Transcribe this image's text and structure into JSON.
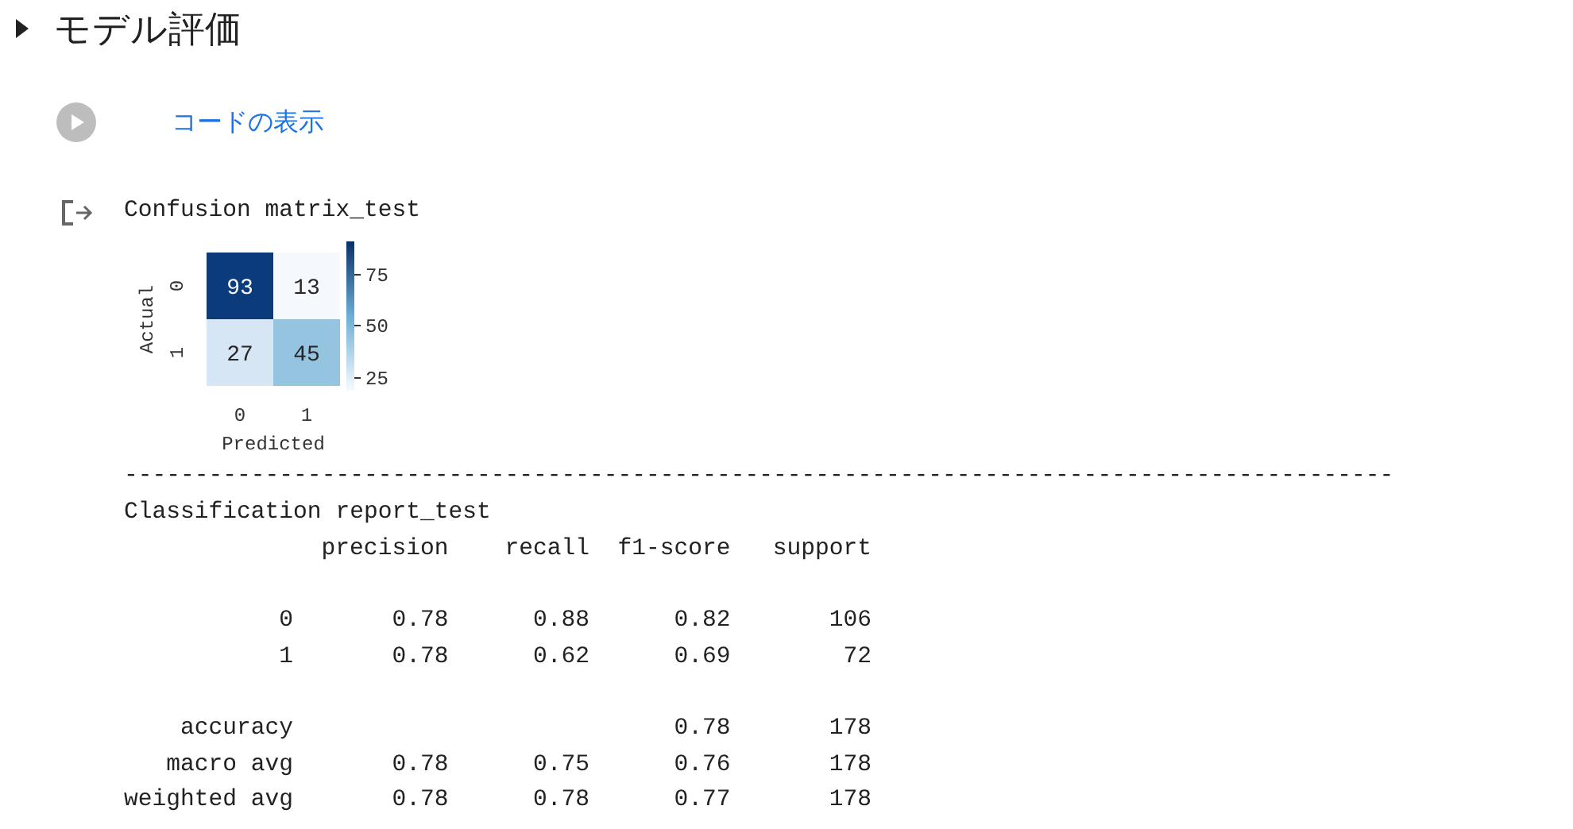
{
  "section": {
    "title": "モデル評価",
    "expanded": false
  },
  "code_cell": {
    "link": "コードの表示"
  },
  "output": {
    "matrix_title": "Confusion matrix_test",
    "heatmap": {
      "ylabel": "Actual",
      "xlabel": "Predicted",
      "row_labels": [
        "0",
        "1"
      ],
      "col_labels": [
        "0",
        "1"
      ],
      "cells": [
        [
          {
            "value": "93",
            "color": "#0c3b7c"
          },
          {
            "value": "13",
            "color": "#f5f9fe"
          }
        ],
        [
          {
            "value": "27",
            "color": "#d6e6f4"
          },
          {
            "value": "45",
            "color": "#94c4df"
          }
        ]
      ],
      "colorbar_ticks": [
        "75",
        "50",
        "25"
      ]
    },
    "separator": "------------------------------------------------------------------------------------------",
    "report_title": "Classification report_test",
    "columns": [
      "precision",
      "recall",
      "f1-score",
      "support"
    ],
    "row_groups": [
      [
        {
          "label": "0",
          "precision": "0.78",
          "recall": "0.88",
          "f1_score": "0.82",
          "support": "106"
        },
        {
          "label": "1",
          "precision": "0.78",
          "recall": "0.62",
          "f1_score": "0.69",
          "support": "72"
        }
      ],
      [
        {
          "label": "accuracy",
          "f1_score": "0.78",
          "support": "178"
        },
        {
          "label": "macro avg",
          "precision": "0.78",
          "recall": "0.75",
          "f1_score": "0.76",
          "support": "178"
        },
        {
          "label": "weighted avg",
          "precision": "0.78",
          "recall": "0.78",
          "f1_score": "0.77",
          "support": "178"
        }
      ]
    ]
  }
}
